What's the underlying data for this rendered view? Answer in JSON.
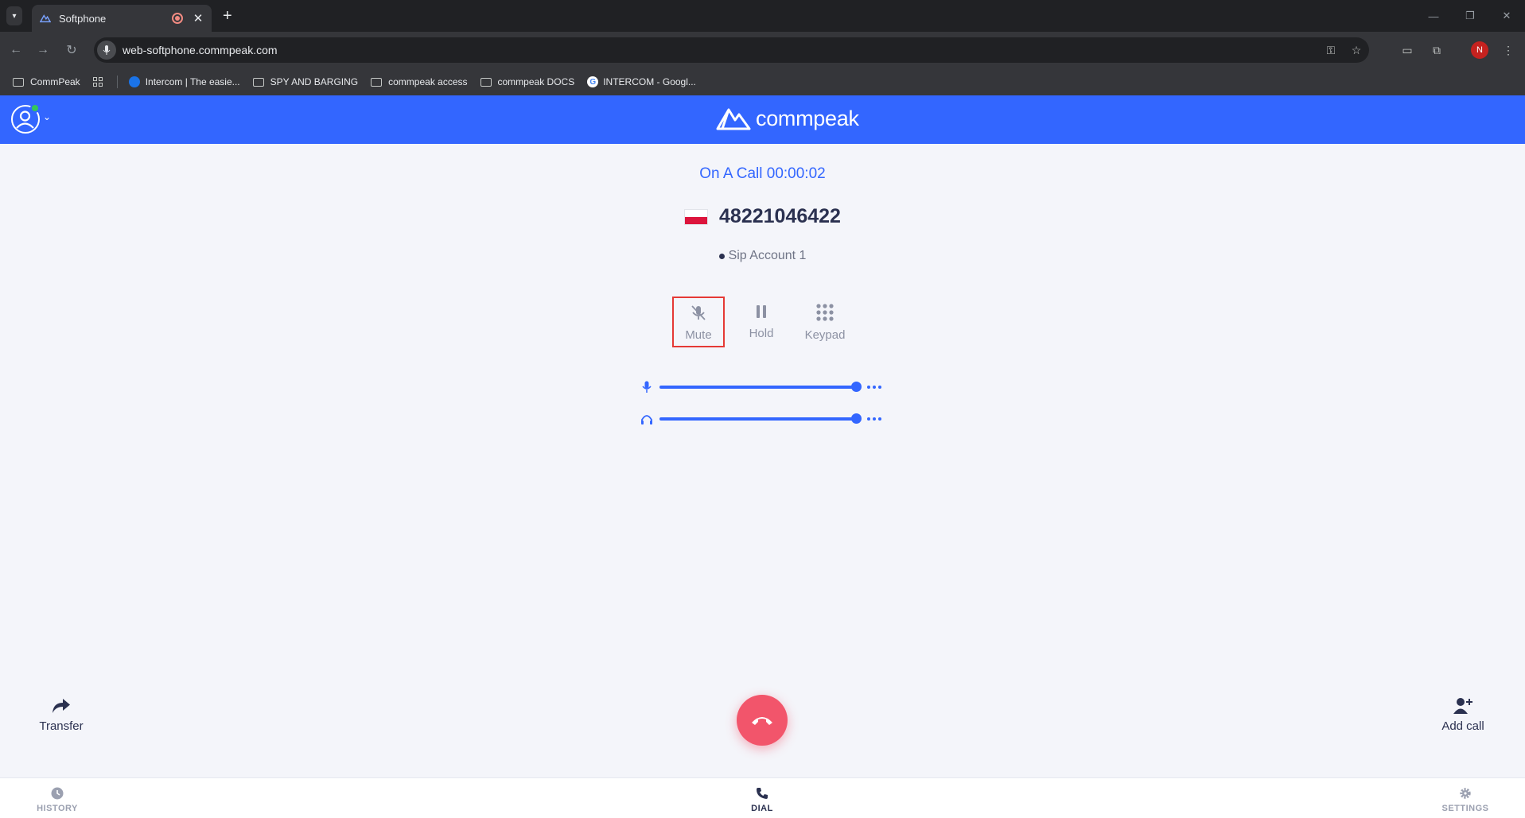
{
  "browser": {
    "tab_title": "Softphone",
    "url": "web-softphone.commpeak.com",
    "bookmarks": [
      {
        "label": "CommPeak",
        "icon": "folder-icon"
      },
      {
        "label": "Intercom | The easie...",
        "icon": "intercom-icon"
      },
      {
        "label": "SPY AND BARGING",
        "icon": "folder-icon"
      },
      {
        "label": "commpeak access",
        "icon": "folder-icon"
      },
      {
        "label": "commpeak DOCS",
        "icon": "folder-icon"
      },
      {
        "label": "INTERCOM - Googl...",
        "icon": "google-icon"
      }
    ],
    "profile_initial": "N"
  },
  "app": {
    "brand": "commpeak",
    "brand_color": "#3366ff"
  },
  "call": {
    "status": "On A Call 00:00:02",
    "number": "48221046422",
    "country_flag": "poland-flag-icon",
    "account": "Sip Account 1",
    "controls": {
      "mute": "Mute",
      "hold": "Hold",
      "keypad": "Keypad"
    },
    "mic_level": 1.0,
    "speaker_level": 1.0,
    "transfer": "Transfer",
    "add_call": "Add call",
    "hangup_color": "#f2556b"
  },
  "nav": {
    "history": "HISTORY",
    "dial": "DIAL",
    "settings": "SETTINGS",
    "active": "dial"
  }
}
